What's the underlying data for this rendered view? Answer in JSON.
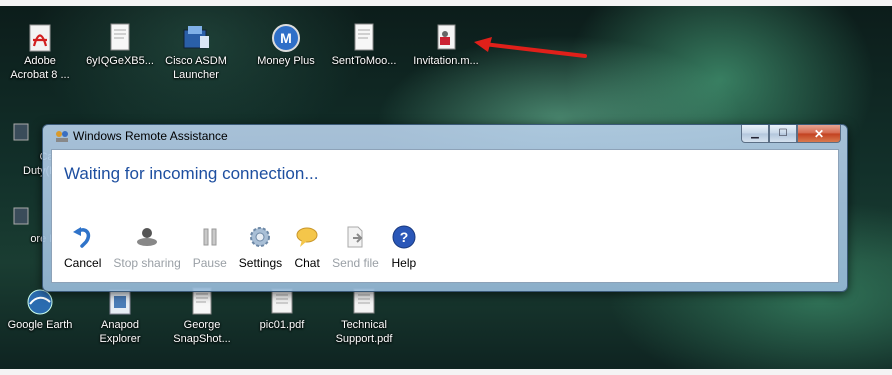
{
  "desktop": {
    "icons": [
      {
        "label1": "Adobe",
        "label2": "Acrobat 8 ...",
        "icon": "adobe-acrobat-icon"
      },
      {
        "label1": "6yIQGeXB5...",
        "label2": "",
        "icon": "document-icon"
      },
      {
        "label1": "Cisco ASDM",
        "label2": "Launcher",
        "icon": "cisco-asdm-icon"
      },
      {
        "label1": "Money Plus",
        "label2": "",
        "icon": "money-plus-icon"
      },
      {
        "label1": "SentToMoo...",
        "label2": "",
        "icon": "document-icon"
      },
      {
        "label1": "Invitation.m...",
        "label2": "",
        "icon": "invitation-file-icon"
      }
    ],
    "left_partial": [
      {
        "label1": "Cal",
        "label2": "Duty(F"
      },
      {
        "label1": "ore F",
        "label2": ""
      }
    ],
    "bottom_icons": [
      {
        "label1": "Google Earth",
        "label2": "",
        "icon": "google-earth-icon"
      },
      {
        "label1": "Anapod",
        "label2": "Explorer",
        "icon": "anapod-explorer-icon"
      },
      {
        "label1": "George",
        "label2": "SnapShot...",
        "icon": "document-icon"
      },
      {
        "label1": "pic01.pdf",
        "label2": "",
        "icon": "pdf-icon"
      },
      {
        "label1": "Technical",
        "label2": "Support.pdf",
        "icon": "pdf-icon"
      }
    ]
  },
  "window": {
    "title": "Windows Remote Assistance",
    "status": "Waiting for incoming connection...",
    "toolbar": [
      {
        "label": "Cancel",
        "icon": "cancel-icon",
        "enabled": true
      },
      {
        "label": "Stop sharing",
        "icon": "stop-sharing-icon",
        "enabled": false
      },
      {
        "label": "Pause",
        "icon": "pause-icon",
        "enabled": false
      },
      {
        "label": "Settings",
        "icon": "settings-icon",
        "enabled": true
      },
      {
        "label": "Chat",
        "icon": "chat-icon",
        "enabled": true
      },
      {
        "label": "Send file",
        "icon": "send-file-icon",
        "enabled": false
      },
      {
        "label": "Help",
        "icon": "help-icon",
        "enabled": true
      }
    ]
  },
  "colors": {
    "status_text": "#1e4fa0",
    "arrow": "#e0201a"
  }
}
